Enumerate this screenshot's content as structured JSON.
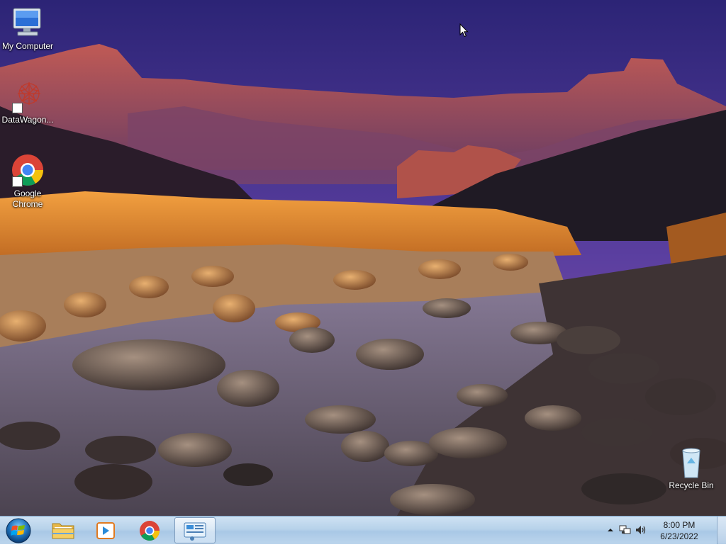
{
  "desktop": {
    "icons": [
      {
        "label": "My Computer",
        "icon": "computer-icon"
      },
      {
        "label": "DataWagon...",
        "icon": "datawagon-icon"
      },
      {
        "label": "Google Chrome",
        "icon": "chrome-icon"
      },
      {
        "label": "Recycle Bin",
        "icon": "recycle-bin-icon"
      }
    ]
  },
  "taskbar": {
    "start_icon": "windows-start-icon",
    "pinned": [
      {
        "name": "Windows Explorer",
        "icon": "folder-icon"
      },
      {
        "name": "Windows Media Player",
        "icon": "media-player-icon"
      },
      {
        "name": "Google Chrome",
        "icon": "chrome-icon"
      },
      {
        "name": "Control Panel",
        "icon": "control-panel-icon"
      }
    ],
    "tray": {
      "icons": [
        "chevron-up-icon",
        "network-icon",
        "volume-icon"
      ],
      "time": "8:00 PM",
      "date": "6/23/2022"
    }
  },
  "colors": {
    "sky_top": "#3b2a86",
    "taskbar": "#b7d2ea",
    "chrome_red": "#db4437",
    "chrome_yellow": "#f4c20d",
    "chrome_green": "#0f9d58",
    "chrome_blue": "#4285f4"
  }
}
